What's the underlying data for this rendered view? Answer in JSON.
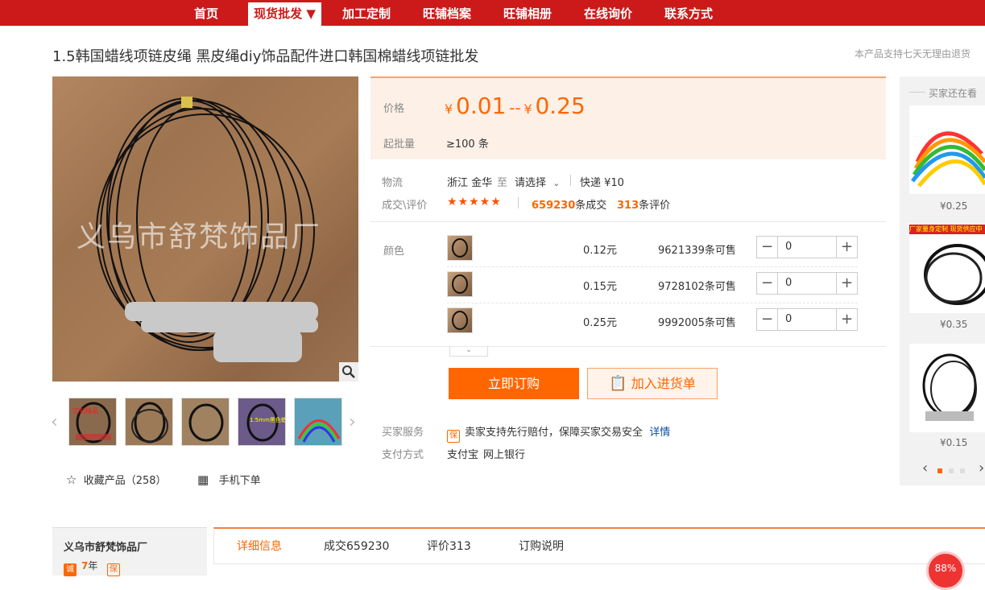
{
  "nav": {
    "items": [
      "首页",
      "现货批发",
      "加工定制",
      "旺铺档案",
      "旺铺相册",
      "在线询价",
      "联系方式"
    ],
    "active_suffix": "▼"
  },
  "product": {
    "title": "1.5韩国蜡线项链皮绳 黑皮绳diy饰品配件进口韩国棉蜡线项链批发",
    "return_note": "本产品支持七天无理由退货",
    "watermark": "义乌市舒梵饰品厂",
    "thumb_captions": [
      "定制精品",
      "",
      "",
      "1.5mm黑色蜡线",
      ""
    ]
  },
  "price": {
    "label": "价格",
    "currency": "¥",
    "low": "0.01",
    "separator": "--",
    "high": "0.25",
    "moq_label": "起批量",
    "moq_value": "≥100 条"
  },
  "logistics": {
    "label": "物流",
    "from": "浙江 金华",
    "to_word": "至",
    "destination": "请选择",
    "shipping": "快递 ¥10"
  },
  "reviews": {
    "label": "成交\\评价",
    "stars": "★★★★★",
    "deals_count": "659230",
    "deals_suffix": "条成交",
    "review_count": "313",
    "review_suffix": "条评价"
  },
  "sku": {
    "label": "颜色",
    "rows": [
      {
        "price": "0.12元",
        "stock": "9621339条可售",
        "qty": "0"
      },
      {
        "price": "0.15元",
        "stock": "9728102条可售",
        "qty": "0"
      },
      {
        "price": "0.25元",
        "stock": "9992005条可售",
        "qty": "0"
      }
    ]
  },
  "actions": {
    "buy_now": "立即订购",
    "add_cart": "加入进货单"
  },
  "service": {
    "label": "买家服务",
    "icon_text": "保",
    "text": "卖家支持先行赔付，保障买家交易安全",
    "link": "详情",
    "payment_label": "支付方式",
    "payment_1": "支付宝",
    "payment_2": "网上银行"
  },
  "extras": {
    "favorite": "收藏产品（258）",
    "mobile_order": "手机下单"
  },
  "sidebar": {
    "title": "买家还在看",
    "items": [
      {
        "price": "¥0.25",
        "banner": ""
      },
      {
        "price": "¥0.35",
        "banner": "厂家量身定制 现货供应中"
      },
      {
        "price": "¥0.15",
        "banner": ""
      }
    ]
  },
  "shop": {
    "name": "义乌市舒梵饰品厂",
    "years_icon": "诚",
    "years": "7",
    "years_unit": "年",
    "badge_icon": "保"
  },
  "tabs": {
    "items": [
      "详细信息",
      "成交659230",
      "评价313",
      "订购说明"
    ]
  },
  "floating": {
    "percent": "88%"
  }
}
